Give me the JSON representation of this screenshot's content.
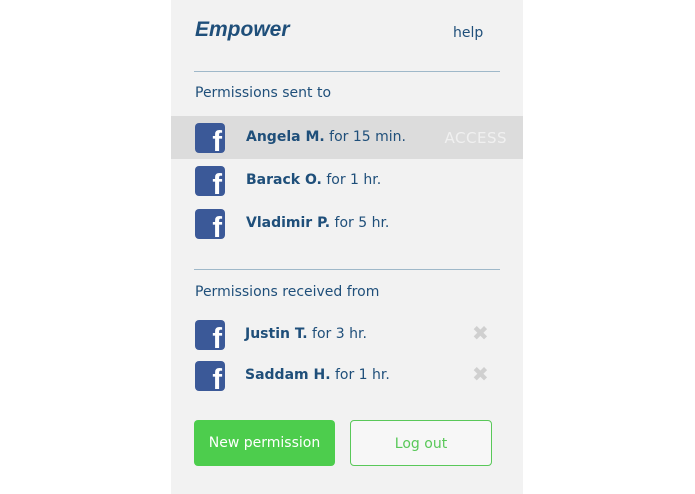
{
  "header": {
    "brand": "Empower",
    "help": "help"
  },
  "sent": {
    "title": "Permissions sent to",
    "action_label": "ACCESS",
    "items": [
      {
        "icon": "facebook-icon",
        "name": "Angela M.",
        "duration": "for 15 min."
      },
      {
        "icon": "facebook-icon",
        "name": "Barack O.",
        "duration": "for 1 hr."
      },
      {
        "icon": "facebook-icon",
        "name": "Vladimir P.",
        "duration": "for 5 hr."
      }
    ]
  },
  "received": {
    "title": "Permissions received from",
    "items": [
      {
        "icon": "facebook-icon",
        "name": "Justin T.",
        "duration": "for 3 hr."
      },
      {
        "icon": "facebook-icon",
        "name": "Saddam H.",
        "duration": "for 1 hr."
      }
    ]
  },
  "actions": {
    "new_permission": "New permission",
    "logout": "Log out"
  },
  "colors": {
    "accent": "#4dcd4d",
    "text": "#1f4f7a",
    "facebook": "#3b5998"
  }
}
